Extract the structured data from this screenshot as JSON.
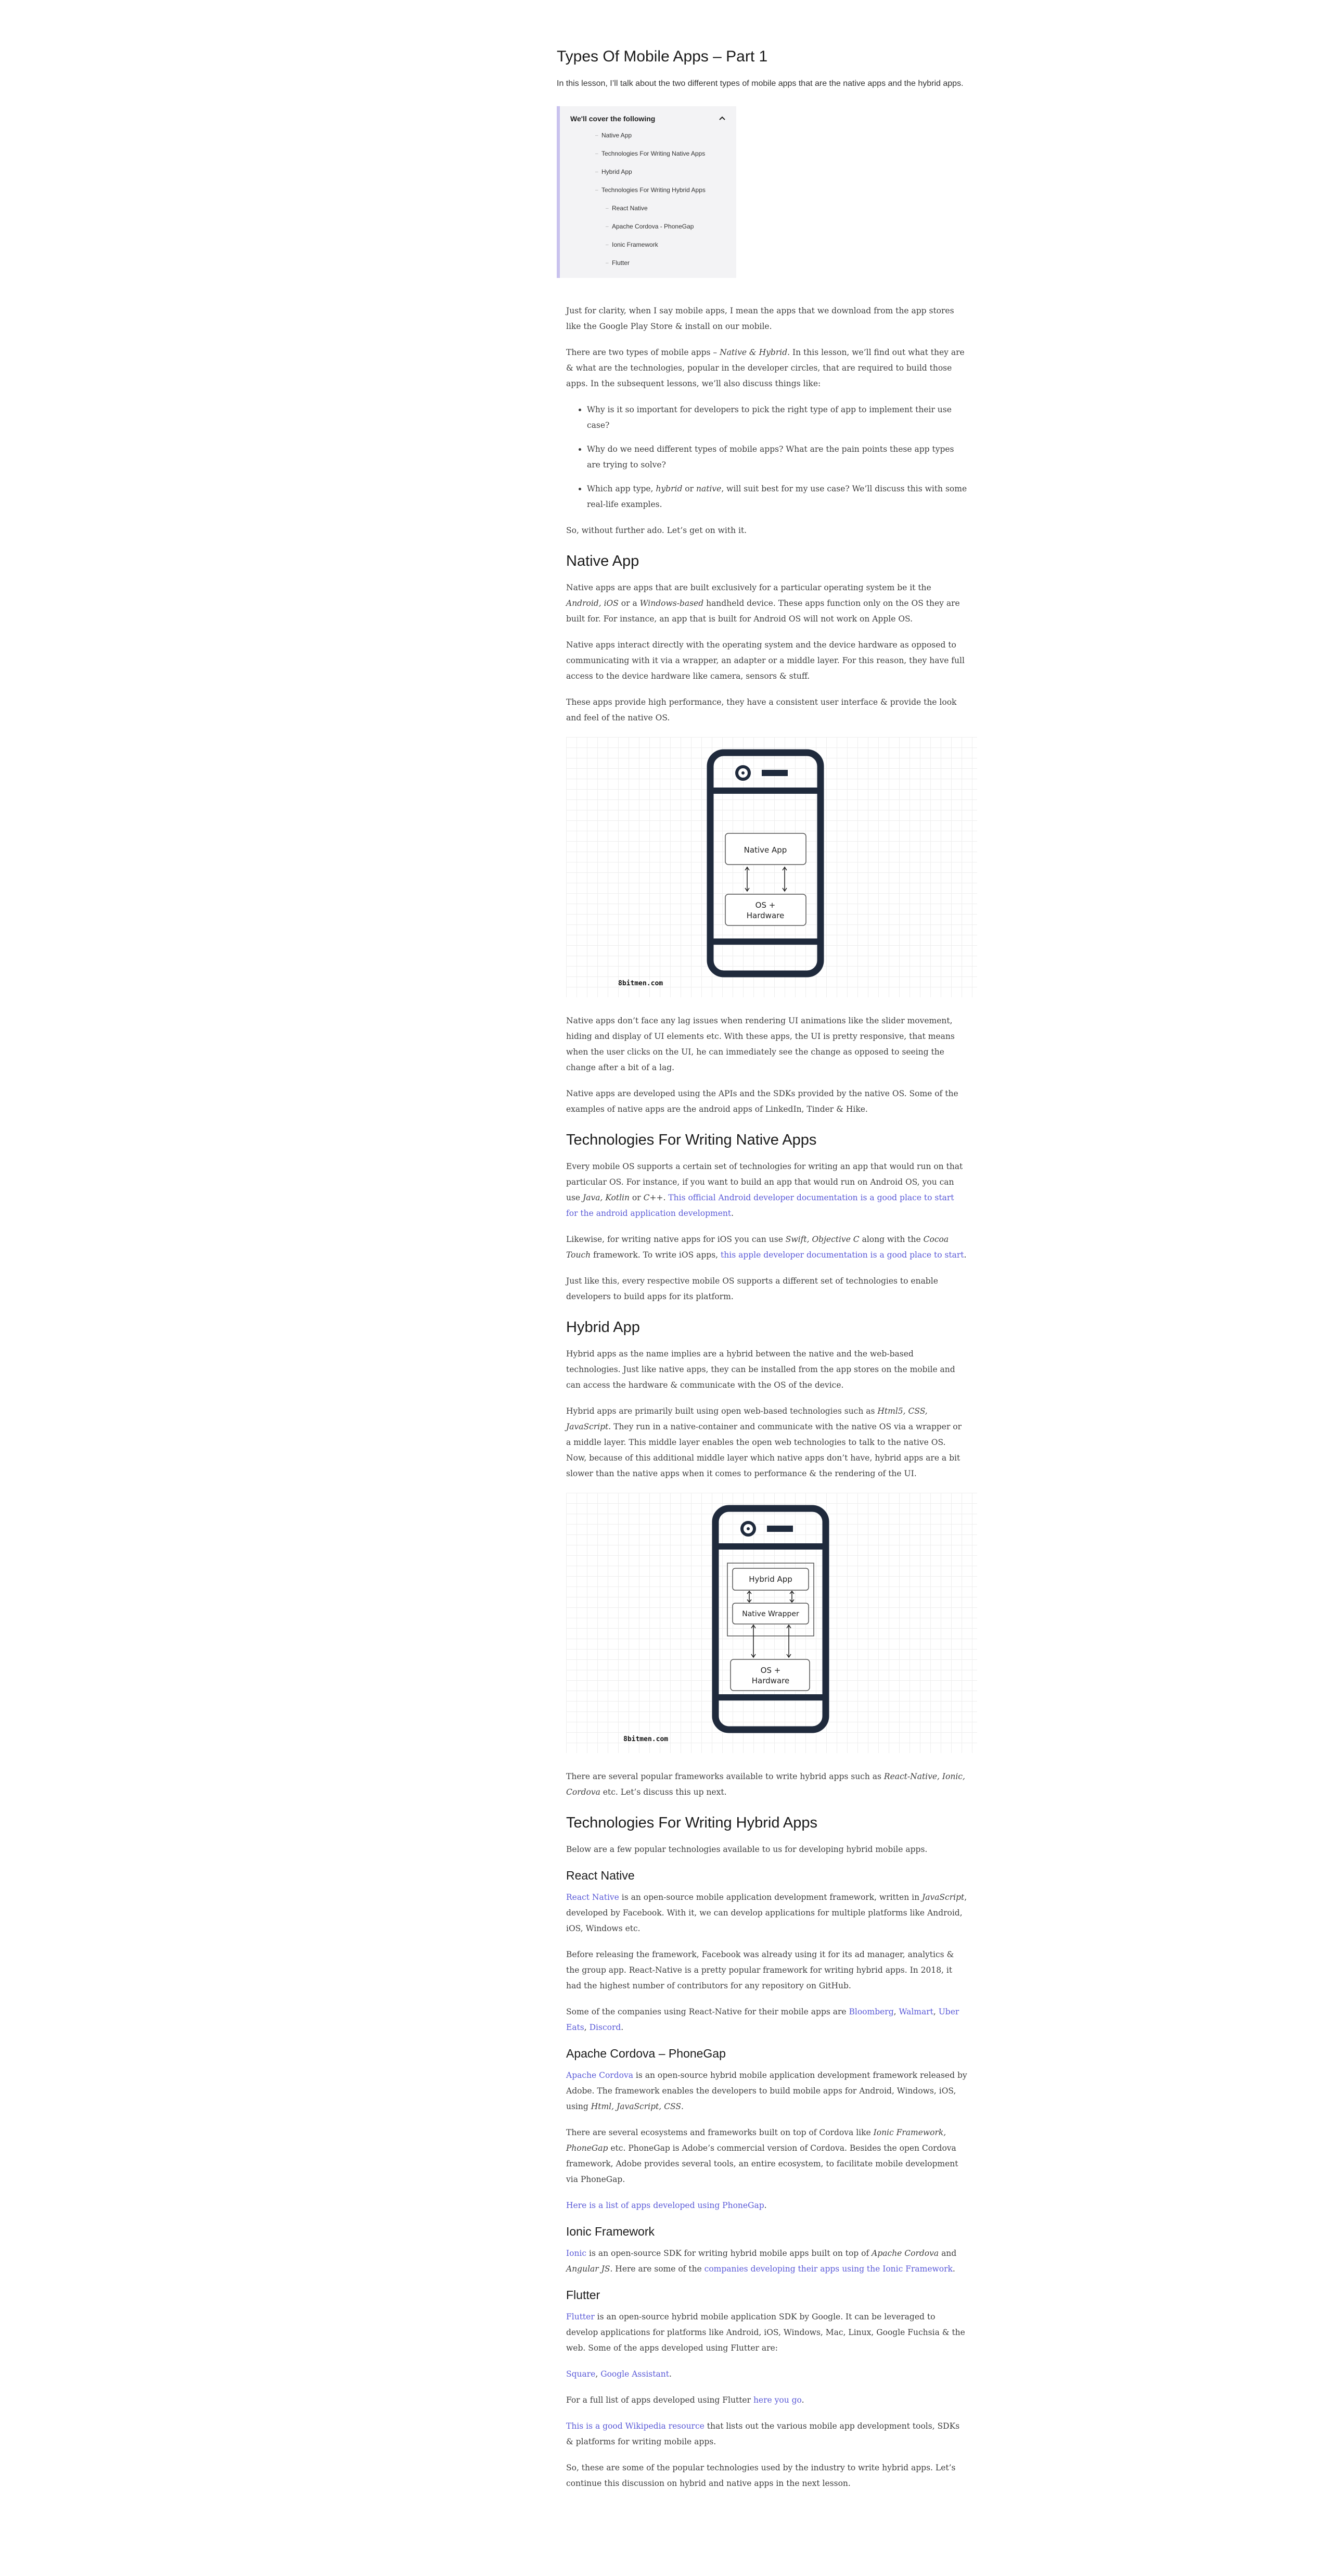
{
  "title": "Types Of Mobile Apps – Part 1",
  "subtitle": "In this lesson, I’ll talk about the two different types of mobile apps that are the native apps and the hybrid apps.",
  "toc": {
    "heading": "We'll cover the following",
    "toggle_icon": "chevron-up-icon",
    "items": [
      {
        "label": "Native App",
        "level": 1
      },
      {
        "label": "Technologies For Writing Native Apps",
        "level": 1
      },
      {
        "label": "Hybrid App",
        "level": 1
      },
      {
        "label": "Technologies For Writing Hybrid Apps",
        "level": 1
      },
      {
        "label": "React Native",
        "level": 2
      },
      {
        "label": "Apache Cordova - PhoneGap",
        "level": 2
      },
      {
        "label": "Ionic Framework",
        "level": 2
      },
      {
        "label": "Flutter",
        "level": 2
      }
    ]
  },
  "intro": {
    "p1": "Just for clarity, when I say mobile apps, I mean the apps that we download from the app stores like the Google Play Store & install on our mobile.",
    "p2_a": "There are two types of mobile apps – ",
    "p2_em": "Native & Hybrid",
    "p2_b": ". In this lesson, we’ll find out what they are & what are the technologies, popular in the developer circles, that are required to build those apps. In the subsequent lessons, we’ll also discuss things like:",
    "b1": "Why is it so important for developers to pick the right type of app to implement their use case?",
    "b2": "Why do we need different types of mobile apps? What are the pain points these app types are trying to solve?",
    "b3_a": "Which app type, ",
    "b3_em1": "hybrid",
    "b3_b": " or ",
    "b3_em2": "native",
    "b3_c": ", will suit best for my use case? We’ll discuss this with some real-life examples.",
    "p3": "So, without further ado. Let’s get on with it."
  },
  "native": {
    "heading": "Native App",
    "p1_a": "Native apps are apps that are built exclusively for a particular operating system be it the ",
    "p1_em1": "Android, iOS",
    "p1_b": " or a ",
    "p1_em2": "Windows-based",
    "p1_c": " handheld device. These apps function only on the OS they are built for. For instance, an app that is built for Android OS will not work on Apple OS.",
    "p2": "Native apps interact directly with the operating system and the device hardware as opposed to communicating with it via a wrapper, an adapter or a middle layer. For this reason, they have full access to the device hardware like camera, sensors & stuff.",
    "p3": "These apps provide high performance, they have a consistent user interface & provide the look and feel of the native OS.",
    "fig": {
      "box1": "Native App",
      "box2_l1": "OS +",
      "box2_l2": "Hardware",
      "credit": "8bitmen.com"
    },
    "p4": "Native apps don’t face any lag issues when rendering UI animations like the slider movement, hiding and display of UI elements etc. With these apps, the UI is pretty responsive, that means when the user clicks on the UI, he can immediately see the change as opposed to seeing the change after a bit of a lag.",
    "p5": "Native apps are developed using the APIs and the SDKs provided by the native OS. Some of the examples of native apps are the android apps of LinkedIn, Tinder & Hike."
  },
  "tech_native": {
    "heading": "Technologies For Writing Native Apps",
    "p1_a": "Every mobile OS supports a certain set of technologies for writing an app that would run on that particular OS. For instance, if you want to build an app that would run on Android OS, you can use ",
    "p1_em": "Java, Kotlin",
    "p1_b": " or ",
    "p1_em2": "C++",
    "p1_c": ". ",
    "p1_link": "This official Android developer documentation is a good place to start for the android application development",
    "p1_d": ".",
    "p2_a": "Likewise, for writing native apps for iOS you can use ",
    "p2_em": "Swift, Objective C",
    "p2_b": " along with the ",
    "p2_em2": "Cocoa Touch",
    "p2_c": " framework. To write iOS apps, ",
    "p2_link": "this apple developer documentation is a good place to start",
    "p2_d": ".",
    "p3": "Just like this, every respective mobile OS supports a different set of technologies to enable developers to build apps for its platform."
  },
  "hybrid": {
    "heading": "Hybrid App",
    "p1": "Hybrid apps as the name implies are a hybrid between the native and the web-based technologies. Just like native apps, they can be installed from the app stores on the mobile and can access the hardware & communicate with the OS of the device.",
    "p2_a": "Hybrid apps are primarily built using open web-based technologies such as ",
    "p2_em": "Html5, CSS, JavaScript",
    "p2_b": ". They run in a native-container and communicate with the native OS via a wrapper or a middle layer. This middle layer enables the open web technologies to talk to the native OS. Now, because of this additional middle layer which native apps don’t have, hybrid apps are a bit slower than the native apps when it comes to performance & the rendering of the UI.",
    "fig": {
      "box1": "Hybrid App",
      "box2": "Native Wrapper",
      "box3_l1": "OS +",
      "box3_l2": "Hardware",
      "credit": "8bitmen.com"
    },
    "p3_a": "There are several popular frameworks available to write hybrid apps such as ",
    "p3_em": "React-Native, Ionic, Cordova",
    "p3_b": " etc. Let’s discuss this up next."
  },
  "tech_hybrid": {
    "heading": "Technologies For Writing Hybrid Apps",
    "p1": "Below are a few popular technologies available to us for developing hybrid mobile apps.",
    "rn": {
      "heading": "React Native",
      "link": "React Native",
      "p1_a": " is an open-source mobile application development framework, written in ",
      "p1_em": "JavaScript",
      "p1_b": ", developed by Facebook. With it, we can develop applications for multiple platforms like Android, iOS, Windows etc.",
      "p2": "Before releasing the framework, Facebook was already using it for its ad manager, analytics & the group app. React-Native is a pretty popular framework for writing hybrid apps. In 2018, it had the highest number of contributors for any repository on GitHub.",
      "p3_a": "Some of the companies using React-Native for their mobile apps are ",
      "c1": "Bloomberg",
      "sep1": ", ",
      "c2": "Walmart",
      "sep2": ", ",
      "c3": "Uber Eats",
      "sep3": ", ",
      "c4": "Discord",
      "end": "."
    },
    "cordova": {
      "heading": "Apache Cordova – PhoneGap",
      "link": "Apache Cordova",
      "p1_a": " is an open-source hybrid mobile application development framework released by Adobe. The framework enables the developers to build mobile apps for Android, Windows, iOS, using ",
      "p1_em": "Html, JavaScript, CSS",
      "p1_b": ".",
      "p2_a": "There are several ecosystems and frameworks built on top of Cordova like ",
      "p2_em": "Ionic Framework, PhoneGap",
      "p2_b": " etc. PhoneGap is Adobe’s commercial version of Cordova. Besides the open Cordova framework, Adobe provides several tools, an entire ecosystem, to facilitate mobile development via PhoneGap.",
      "p3_link": "Here is a list of apps developed using PhoneGap",
      "p3_end": "."
    },
    "ionic": {
      "heading": "Ionic Framework",
      "link": "Ionic",
      "p1_a": " is an open-source SDK for writing hybrid mobile apps built on top of ",
      "p1_em": "Apache Cordova",
      "p1_b": " and ",
      "p1_em2": "Angular JS",
      "p1_c": ". Here are some of the ",
      "p1_link": "companies developing their apps using the Ionic Framework",
      "p1_d": "."
    },
    "flutter": {
      "heading": "Flutter",
      "link": "Flutter",
      "p1": " is an open-source hybrid mobile application SDK by Google. It can be leveraged to develop applications for platforms like Android, iOS, Windows, Mac, Linux, Google Fuchsia & the web. Some of the apps developed using Flutter are:",
      "l1": "Square",
      "sep": ", ",
      "l2": "Google Assistant",
      "end": ".",
      "p3_a": "For a full list of apps developed using Flutter ",
      "p3_link": "here you go",
      "p3_end": ".",
      "p4_link": "This is a good Wikipedia resource",
      "p4_b": " that lists out the various mobile app development tools, SDKs & platforms for writing mobile apps.",
      "p5": "So, these are some of the popular technologies used by the industry to write hybrid apps. Let’s continue this discussion on hybrid and native apps in the next lesson."
    }
  },
  "colors": {
    "link": "#5a5ad7",
    "phone": "#1f2a3c",
    "toc_border": "#c9c2ee",
    "toc_bg": "#f3f3f5"
  }
}
